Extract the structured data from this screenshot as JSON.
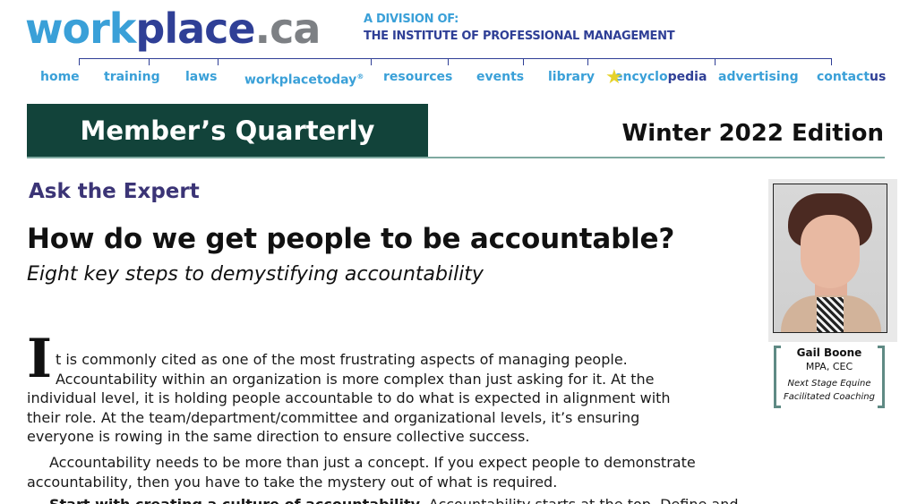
{
  "header": {
    "logo_part1": "work",
    "logo_part2": "place",
    "logo_part3": ".ca",
    "division_line1": "A DIVISION OF:",
    "division_line2": "THE INSTITUTE OF PROFESSIONAL MANAGEMENT"
  },
  "nav": {
    "home": "home",
    "training": "training",
    "laws": "laws",
    "workplacetoday": "workplacetoday",
    "workplacetoday_mark": "®",
    "resources": "resources",
    "events": "events",
    "library": "library",
    "encyclopedia_a": "encyclo",
    "encyclopedia_b": "pedia",
    "advertising": "advertising",
    "contact_a": "contact",
    "contact_b": "us"
  },
  "banner": {
    "title": "Member’s Quarterly",
    "edition": "Winter 2022 Edition"
  },
  "article": {
    "kicker": "Ask the Expert",
    "headline": "How do we get people to be accountable?",
    "subhead": "Eight key steps to demystifying accountability",
    "dropcap": "I",
    "p1_line1": "t is commonly cited as one of the most frustrating aspects of managing people.",
    "p1_line2": "Accountability within an organization is more complex than just asking for it. At the",
    "p1_line3": "individual level, it is holding people accountable to do what is expected in alignment with",
    "p1_line4": "their role. At the team/department/committee and organizational levels, it’s ensuring",
    "p1_line5": "everyone is rowing in the same direction to ensure collective success.",
    "p2_line1": "Accountability needs to be more than just a concept. If you expect people to demonstrate",
    "p2_line2": "accountability, then you have to take the mystery out of what is required.",
    "p3_partial_bold": "Start with creating a culture of accountability.",
    "p3_partial": " Accountability starts at the top. Define and"
  },
  "expert": {
    "name": "Gail Boone",
    "credentials": "MPA, CEC",
    "org_line1": "Next Stage Equine",
    "org_line2": "Facilitated Coaching"
  }
}
